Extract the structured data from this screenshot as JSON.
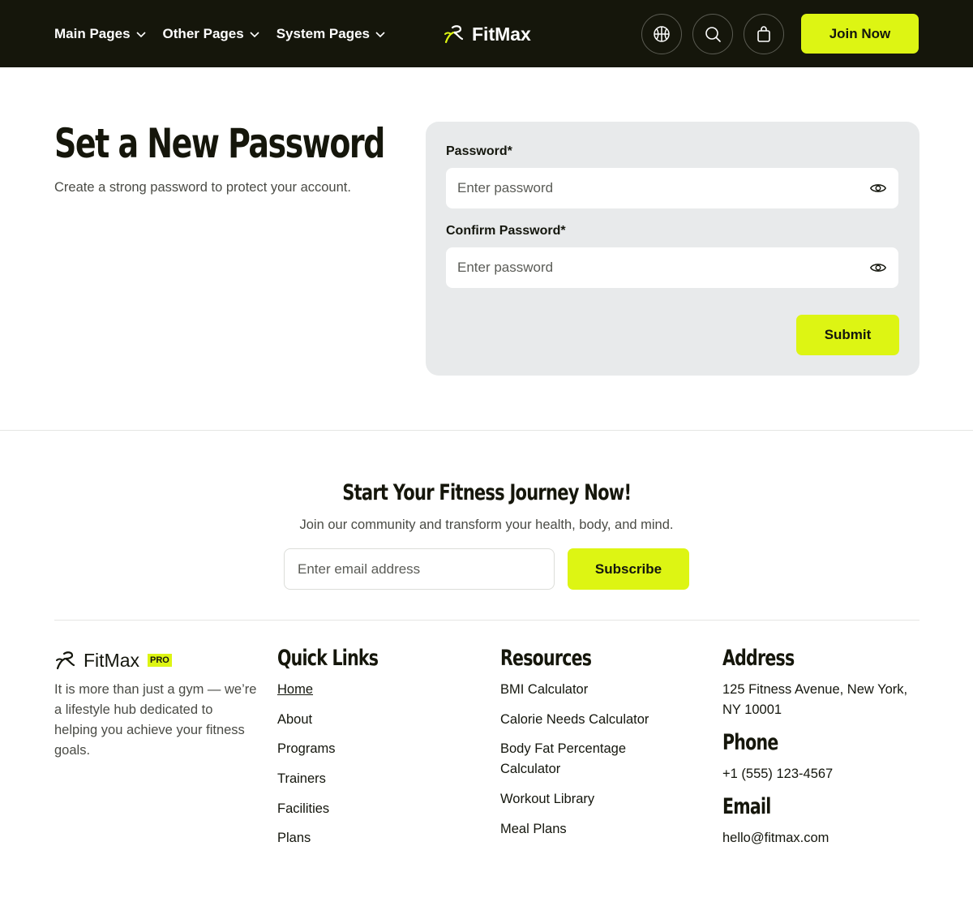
{
  "header": {
    "nav": [
      {
        "label": "Main Pages"
      },
      {
        "label": "Other Pages"
      },
      {
        "label": "System Pages"
      }
    ],
    "logo_text": "FitMax",
    "icons": [
      "basketball-icon",
      "search-icon",
      "shopping-bag-icon"
    ],
    "join_label": "Join Now"
  },
  "main": {
    "title": "Set a New Password",
    "subtitle": "Create a strong password to protect your account.",
    "form": {
      "password_label": "Password*",
      "password_placeholder": "Enter password",
      "confirm_label": "Confirm Password*",
      "confirm_placeholder": "Enter password",
      "submit_label": "Submit"
    }
  },
  "newsletter": {
    "title": "Start Your Fitness Journey Now!",
    "subtitle": "Join our community and transform your health, body, and mind.",
    "email_placeholder": "Enter email address",
    "subscribe_label": "Subscribe"
  },
  "footer": {
    "logo_text": "FitMax",
    "badge": "PRO",
    "description": "It is more than just a gym — we’re a lifestyle hub dedicated to helping you achieve your fitness goals.",
    "quick_links": {
      "title": "Quick Links",
      "items": [
        "Home",
        "About",
        "Programs",
        "Trainers",
        "Facilities",
        "Plans"
      ]
    },
    "resources": {
      "title": "Resources",
      "items": [
        "BMI Calculator",
        "Calorie Needs Calculator",
        "Body Fat Percentage Calculator",
        "Workout Library",
        "Meal Plans"
      ]
    },
    "address": {
      "title": "Address",
      "text": "125 Fitness Avenue, New York, NY 10001"
    },
    "phone": {
      "title": "Phone",
      "text": "+1 (555) 123-4567"
    },
    "email": {
      "title": "Email",
      "text": "hello@fitmax.com"
    }
  },
  "colors": {
    "accent": "#ddf513",
    "header_bg": "#15160b",
    "card_bg": "#e8eaeb"
  }
}
